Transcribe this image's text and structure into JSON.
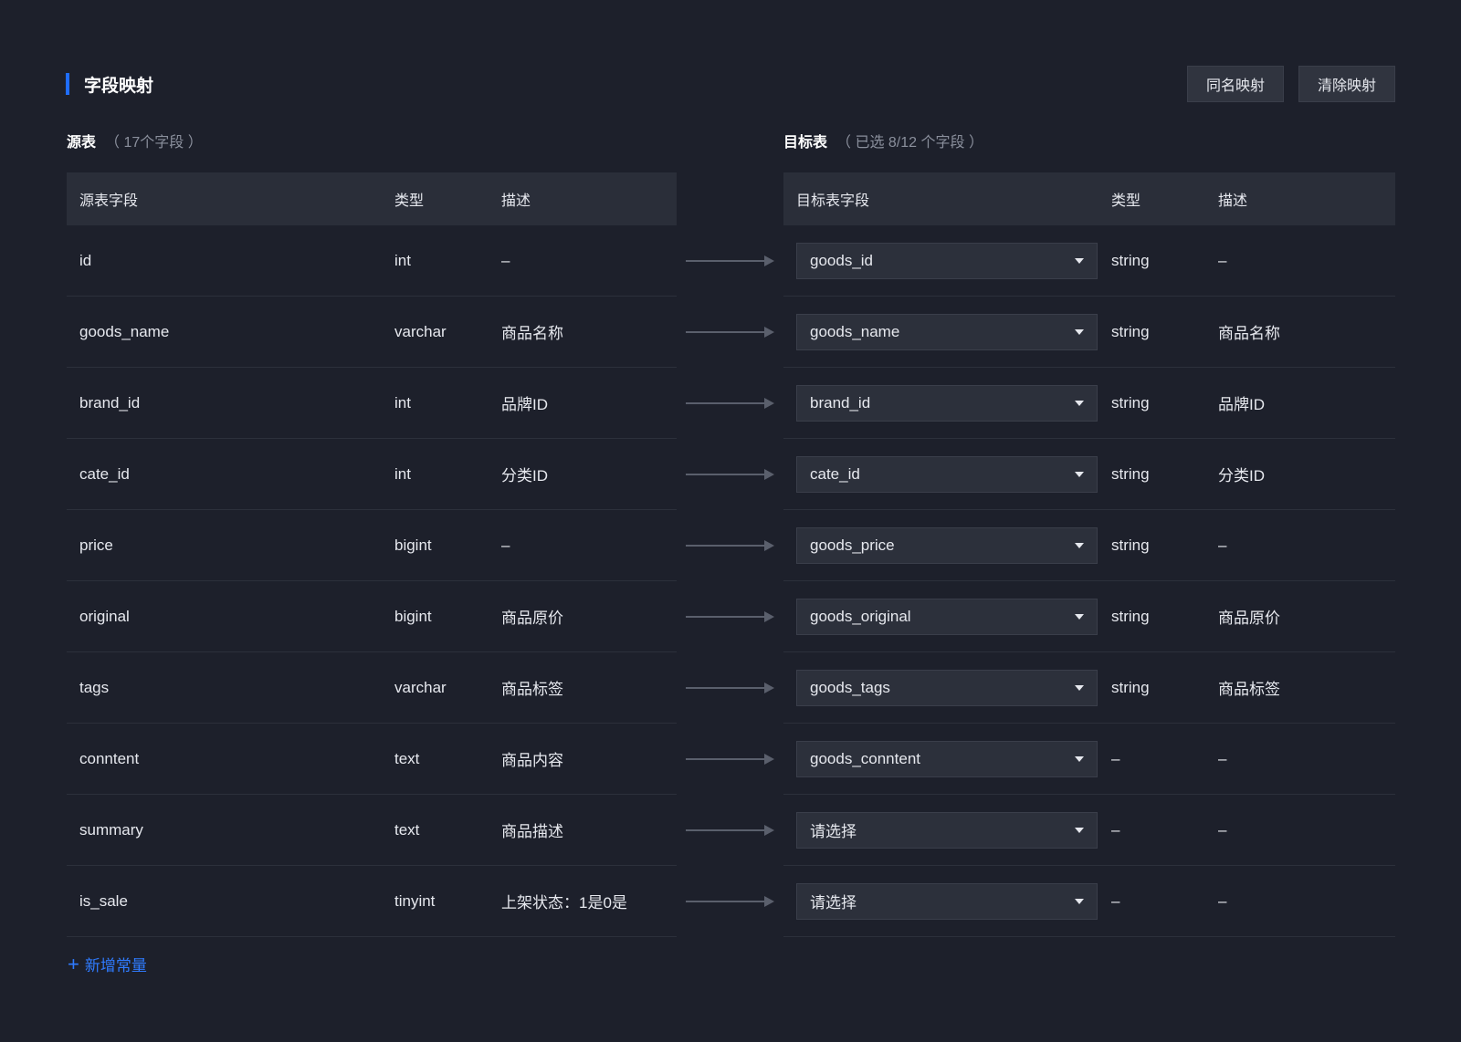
{
  "header": {
    "title": "字段映射",
    "btn_same_name": "同名映射",
    "btn_clear": "清除映射"
  },
  "source": {
    "label": "源表",
    "count": "（ 17个字段 ）",
    "columns": [
      "源表字段",
      "类型",
      "描述"
    ],
    "rows": [
      {
        "name": "id",
        "type": "int",
        "desc": "–"
      },
      {
        "name": "goods_name",
        "type": "varchar",
        "desc": "商品名称"
      },
      {
        "name": "brand_id",
        "type": "int",
        "desc": "品牌ID"
      },
      {
        "name": "cate_id",
        "type": "int",
        "desc": "分类ID"
      },
      {
        "name": "price",
        "type": "bigint",
        "desc": "–"
      },
      {
        "name": "original",
        "type": "bigint",
        "desc": "商品原价"
      },
      {
        "name": "tags",
        "type": "varchar",
        "desc": "商品标签"
      },
      {
        "name": "conntent",
        "type": "text",
        "desc": "商品内容"
      },
      {
        "name": "summary",
        "type": "text",
        "desc": "商品描述"
      },
      {
        "name": "is_sale",
        "type": "tinyint",
        "desc": "上架状态：1是0是"
      }
    ]
  },
  "target": {
    "label": "目标表",
    "count": "（ 已选 8/12 个字段 ）",
    "columns": [
      "目标表字段",
      "类型",
      "描述"
    ],
    "rows": [
      {
        "field": "goods_id",
        "type": "string",
        "desc": "–"
      },
      {
        "field": "goods_name",
        "type": "string",
        "desc": "商品名称"
      },
      {
        "field": "brand_id",
        "type": "string",
        "desc": "品牌ID"
      },
      {
        "field": "cate_id",
        "type": "string",
        "desc": "分类ID"
      },
      {
        "field": "goods_price",
        "type": "string",
        "desc": "–"
      },
      {
        "field": "goods_original",
        "type": "string",
        "desc": "商品原价"
      },
      {
        "field": "goods_tags",
        "type": "string",
        "desc": "商品标签"
      },
      {
        "field": "goods_conntent",
        "type": "–",
        "desc": "–"
      },
      {
        "field": "请选择",
        "type": "–",
        "desc": "–"
      },
      {
        "field": "请选择",
        "type": "–",
        "desc": "–"
      }
    ]
  },
  "add_constant": "新增常量",
  "colors": {
    "background": "#1d202b",
    "header_bg": "#2a2e39",
    "accent": "#1f6dff",
    "link": "#2f7bff"
  }
}
